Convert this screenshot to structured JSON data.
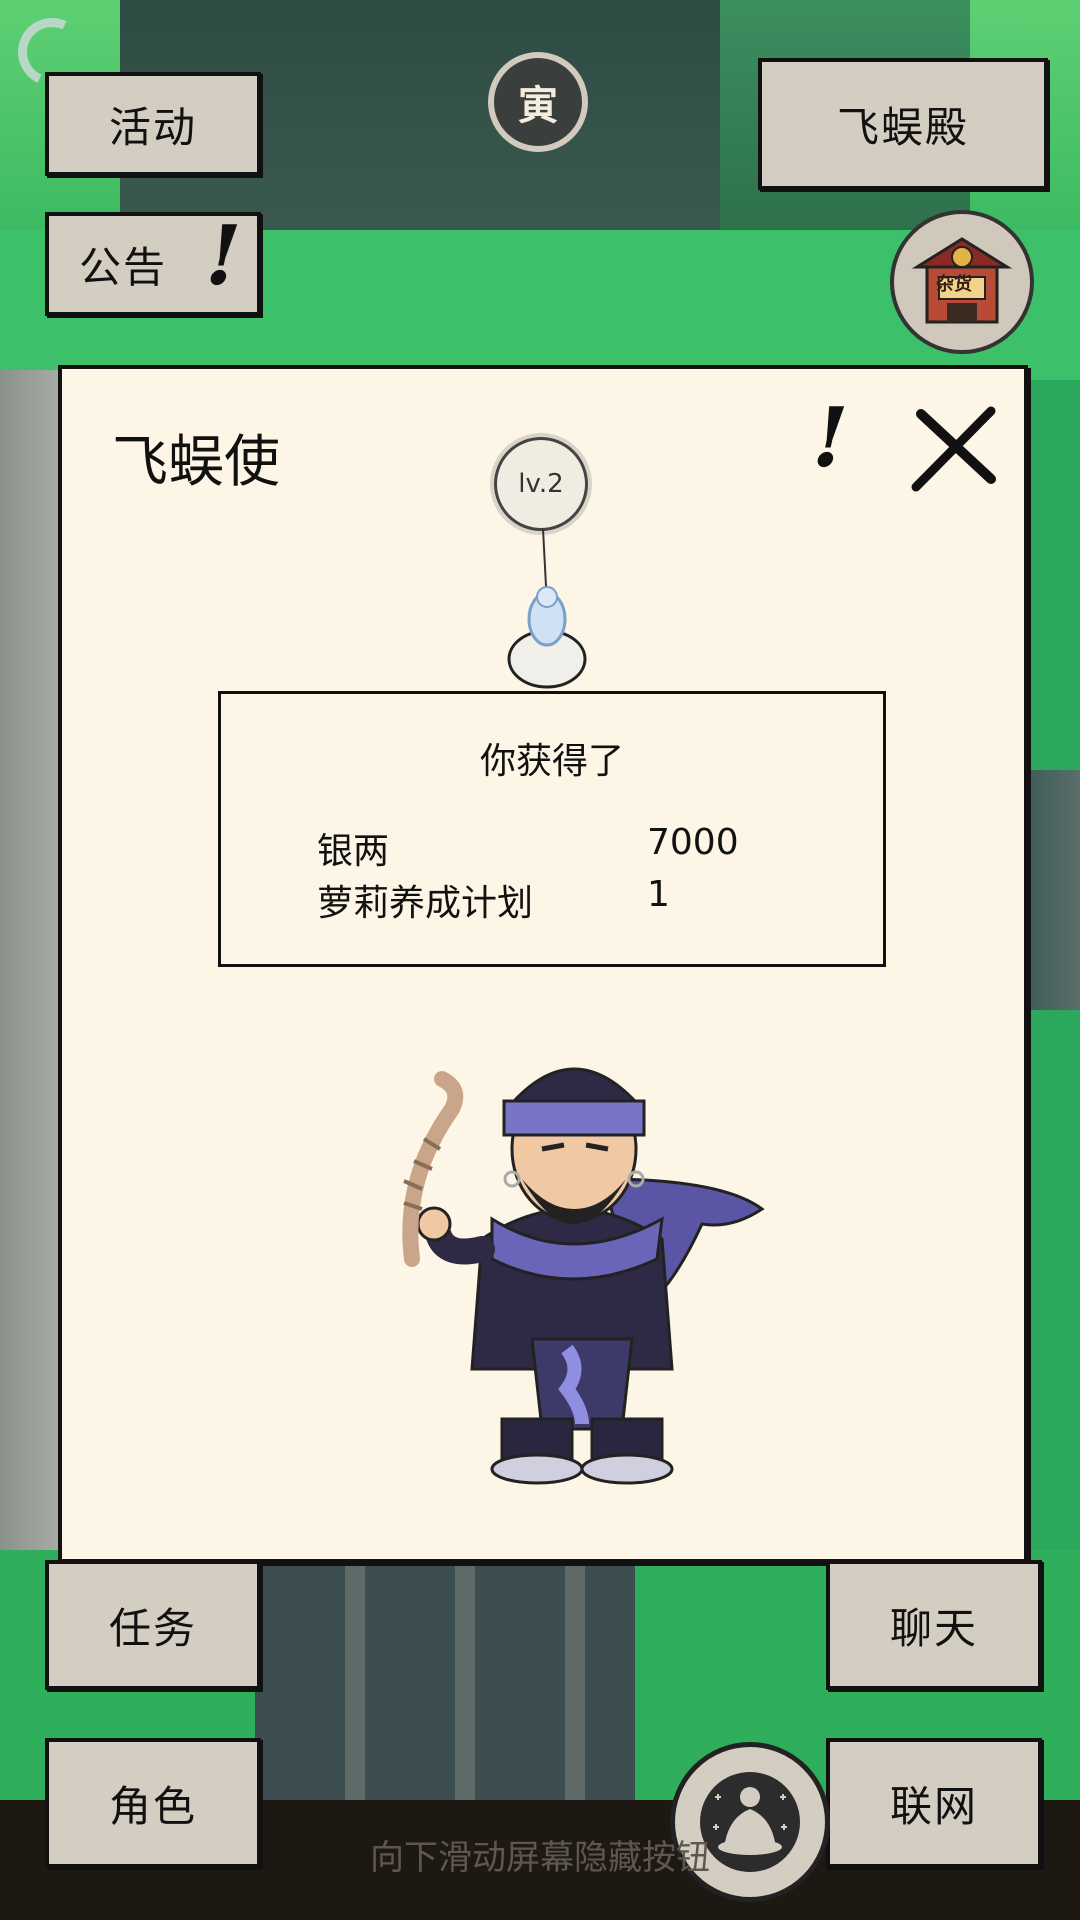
{
  "top_left_buttons": {
    "activity_label": "活动",
    "notice_label": "公告"
  },
  "time_emblem": {
    "glyph": "寅",
    "icon": "time-emblem-icon"
  },
  "top_right": {
    "hall_label": "飞蜈殿",
    "shop_sign": "杂货",
    "shop_icon": "general-store-icon"
  },
  "dialog": {
    "title": "飞蜈使",
    "level": "lv.2",
    "reward_header": "你获得了",
    "rewards": [
      {
        "name": "银两",
        "qty": "7000"
      },
      {
        "name": "萝莉养成计划",
        "qty": "1"
      }
    ],
    "character_icon": "centipede-envoy-character"
  },
  "bottom_buttons": {
    "task_label": "任务",
    "chat_label": "聊天",
    "role_label": "角色",
    "network_label": "联网",
    "meditate_icon": "meditation-icon"
  },
  "hint_text": "向下滑动屏幕隐藏按钮",
  "colors": {
    "button_bg": "#d4cdc1",
    "dialog_bg": "#fdf5e6",
    "scene_green": "#2aa95c"
  }
}
